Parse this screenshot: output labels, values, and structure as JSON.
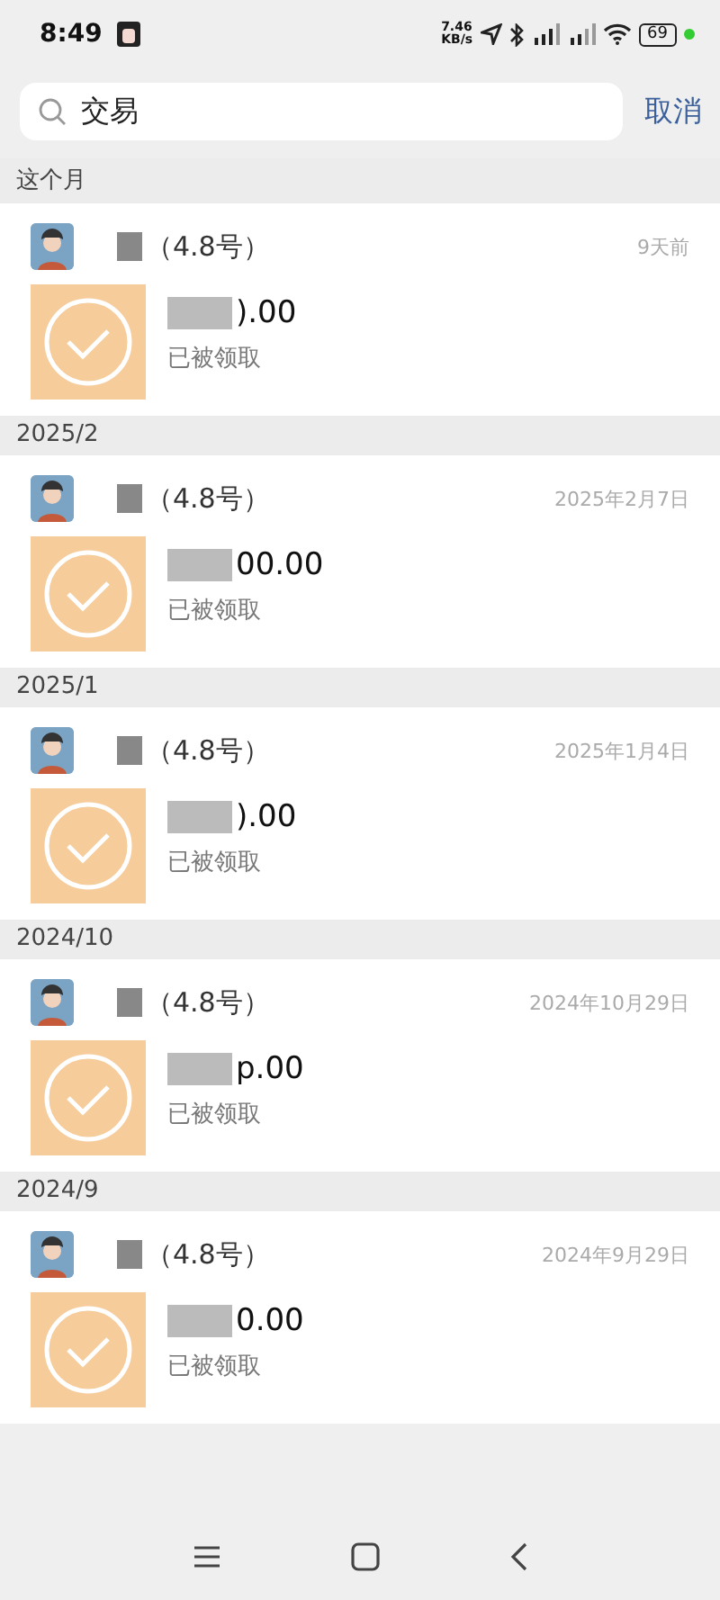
{
  "status_bar": {
    "time": "8:49",
    "net_speed": "7.46",
    "net_unit": "KB/s",
    "battery": "69"
  },
  "search": {
    "value": "交易",
    "cancel": "取消"
  },
  "sections": [
    {
      "title": "这个月",
      "items": [
        {
          "name": "（4.8号）",
          "time": "9天前",
          "amount": ").00",
          "status": "已被领取"
        }
      ]
    },
    {
      "title": "2025/2",
      "items": [
        {
          "name": "（4.8号）",
          "time": "2025年2月7日",
          "amount": "00.00",
          "status": "已被领取"
        }
      ]
    },
    {
      "title": "2025/1",
      "items": [
        {
          "name": "（4.8号）",
          "time": "2025年1月4日",
          "amount": ").00",
          "status": "已被领取"
        }
      ]
    },
    {
      "title": "2024/10",
      "items": [
        {
          "name": "（4.8号）",
          "time": "2024年10月29日",
          "amount": "p.00",
          "status": "已被领取"
        }
      ]
    },
    {
      "title": "2024/9",
      "items": [
        {
          "name": "（4.8号）",
          "time": "2024年9月29日",
          "amount": "0.00",
          "status": "已被领取"
        }
      ]
    }
  ]
}
